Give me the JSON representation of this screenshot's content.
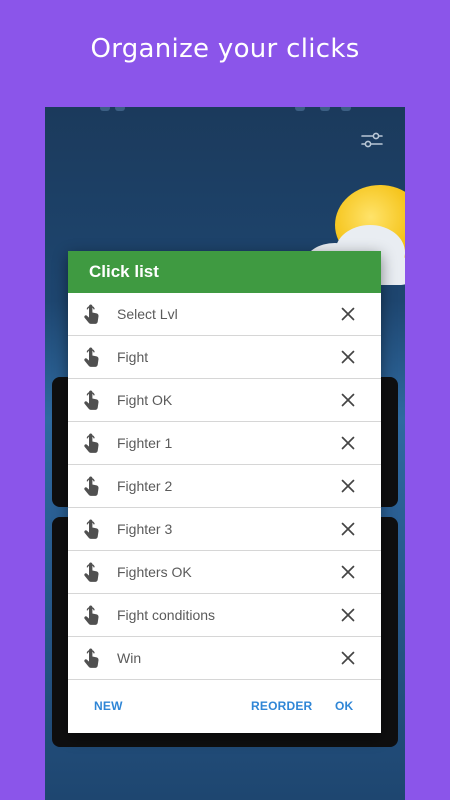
{
  "promo": {
    "title": "Organize your clicks"
  },
  "dialog": {
    "title": "Click list",
    "items": [
      {
        "label": "Select Lvl"
      },
      {
        "label": "Fight"
      },
      {
        "label": "Fight OK"
      },
      {
        "label": "Fighter 1"
      },
      {
        "label": "Fighter 2"
      },
      {
        "label": "Fighter 3"
      },
      {
        "label": "Fighters OK"
      },
      {
        "label": "Fight conditions"
      },
      {
        "label": "Win"
      }
    ],
    "actions": {
      "new": "NEW",
      "reorder": "REORDER",
      "ok": "OK"
    }
  },
  "icons": {
    "item": "touch-hand-icon",
    "remove": "close-icon",
    "settings": "tune-sliders-icon"
  },
  "colors": {
    "background": "#8b55ea",
    "header": "#3f9a41",
    "action": "#2f86d6",
    "item_text": "#5a5a5a"
  }
}
